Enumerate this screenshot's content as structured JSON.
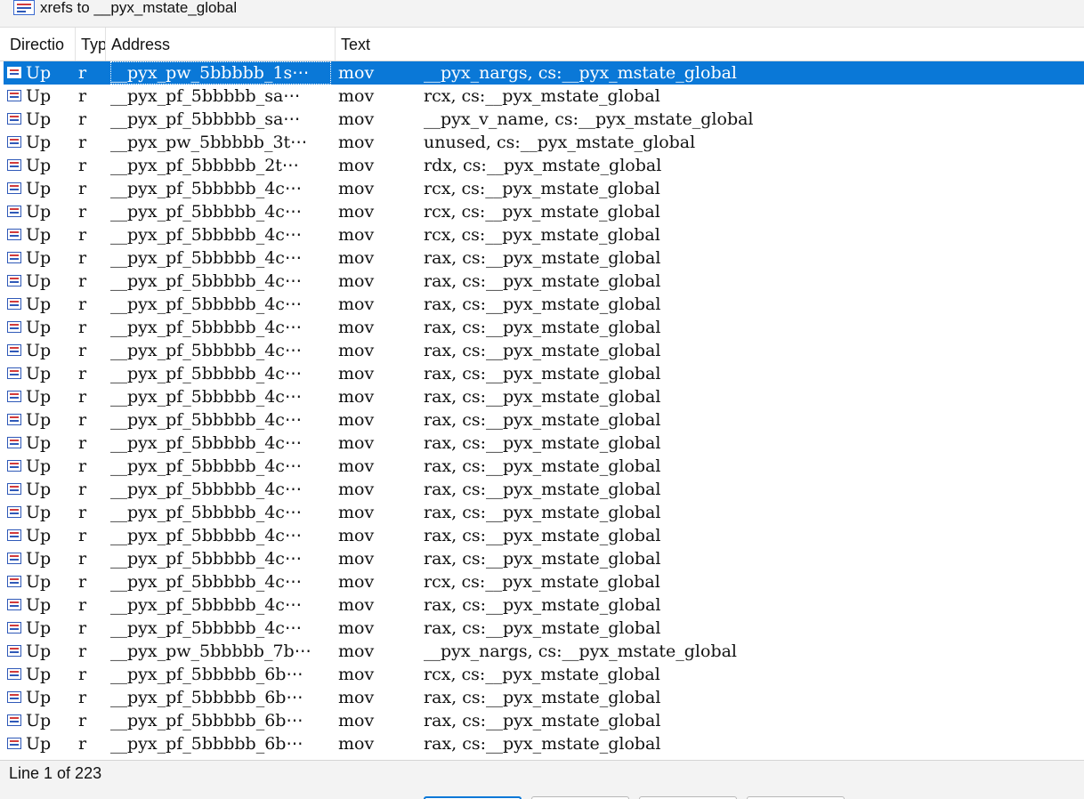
{
  "window": {
    "title": "xrefs to __pyx_mstate_global"
  },
  "columns": {
    "direction": "Directio",
    "type": "Typ",
    "address": "Address",
    "text": "Text"
  },
  "rows": [
    {
      "direction": "Up",
      "type": "r",
      "address": "__pyx_pw_5bbbbb_1s⋯",
      "op": "mov",
      "args": "__pyx_nargs, cs:__pyx_mstate_global",
      "selected": true
    },
    {
      "direction": "Up",
      "type": "r",
      "address": "__pyx_pf_5bbbbb_sa⋯",
      "op": "mov",
      "args": "rcx, cs:__pyx_mstate_global"
    },
    {
      "direction": "Up",
      "type": "r",
      "address": "__pyx_pf_5bbbbb_sa⋯",
      "op": "mov",
      "args": "__pyx_v_name, cs:__pyx_mstate_global"
    },
    {
      "direction": "Up",
      "type": "r",
      "address": "__pyx_pw_5bbbbb_3t⋯",
      "op": "mov",
      "args": "unused, cs:__pyx_mstate_global"
    },
    {
      "direction": "Up",
      "type": "r",
      "address": "__pyx_pf_5bbbbb_2t⋯",
      "op": "mov",
      "args": "rdx, cs:__pyx_mstate_global"
    },
    {
      "direction": "Up",
      "type": "r",
      "address": "__pyx_pf_5bbbbb_4c⋯",
      "op": "mov",
      "args": "rcx, cs:__pyx_mstate_global"
    },
    {
      "direction": "Up",
      "type": "r",
      "address": "__pyx_pf_5bbbbb_4c⋯",
      "op": "mov",
      "args": "rcx, cs:__pyx_mstate_global"
    },
    {
      "direction": "Up",
      "type": "r",
      "address": "__pyx_pf_5bbbbb_4c⋯",
      "op": "mov",
      "args": "rcx, cs:__pyx_mstate_global"
    },
    {
      "direction": "Up",
      "type": "r",
      "address": "__pyx_pf_5bbbbb_4c⋯",
      "op": "mov",
      "args": "rax, cs:__pyx_mstate_global"
    },
    {
      "direction": "Up",
      "type": "r",
      "address": "__pyx_pf_5bbbbb_4c⋯",
      "op": "mov",
      "args": "rax, cs:__pyx_mstate_global"
    },
    {
      "direction": "Up",
      "type": "r",
      "address": "__pyx_pf_5bbbbb_4c⋯",
      "op": "mov",
      "args": "rax, cs:__pyx_mstate_global"
    },
    {
      "direction": "Up",
      "type": "r",
      "address": "__pyx_pf_5bbbbb_4c⋯",
      "op": "mov",
      "args": "rax, cs:__pyx_mstate_global"
    },
    {
      "direction": "Up",
      "type": "r",
      "address": "__pyx_pf_5bbbbb_4c⋯",
      "op": "mov",
      "args": "rax, cs:__pyx_mstate_global"
    },
    {
      "direction": "Up",
      "type": "r",
      "address": "__pyx_pf_5bbbbb_4c⋯",
      "op": "mov",
      "args": "rax, cs:__pyx_mstate_global"
    },
    {
      "direction": "Up",
      "type": "r",
      "address": "__pyx_pf_5bbbbb_4c⋯",
      "op": "mov",
      "args": "rax, cs:__pyx_mstate_global"
    },
    {
      "direction": "Up",
      "type": "r",
      "address": "__pyx_pf_5bbbbb_4c⋯",
      "op": "mov",
      "args": "rax, cs:__pyx_mstate_global"
    },
    {
      "direction": "Up",
      "type": "r",
      "address": "__pyx_pf_5bbbbb_4c⋯",
      "op": "mov",
      "args": "rax, cs:__pyx_mstate_global"
    },
    {
      "direction": "Up",
      "type": "r",
      "address": "__pyx_pf_5bbbbb_4c⋯",
      "op": "mov",
      "args": "rax, cs:__pyx_mstate_global"
    },
    {
      "direction": "Up",
      "type": "r",
      "address": "__pyx_pf_5bbbbb_4c⋯",
      "op": "mov",
      "args": "rax, cs:__pyx_mstate_global"
    },
    {
      "direction": "Up",
      "type": "r",
      "address": "__pyx_pf_5bbbbb_4c⋯",
      "op": "mov",
      "args": "rax, cs:__pyx_mstate_global"
    },
    {
      "direction": "Up",
      "type": "r",
      "address": "__pyx_pf_5bbbbb_4c⋯",
      "op": "mov",
      "args": "rax, cs:__pyx_mstate_global"
    },
    {
      "direction": "Up",
      "type": "r",
      "address": "__pyx_pf_5bbbbb_4c⋯",
      "op": "mov",
      "args": "rax, cs:__pyx_mstate_global"
    },
    {
      "direction": "Up",
      "type": "r",
      "address": "__pyx_pf_5bbbbb_4c⋯",
      "op": "mov",
      "args": "rcx, cs:__pyx_mstate_global"
    },
    {
      "direction": "Up",
      "type": "r",
      "address": "__pyx_pf_5bbbbb_4c⋯",
      "op": "mov",
      "args": "rax, cs:__pyx_mstate_global"
    },
    {
      "direction": "Up",
      "type": "r",
      "address": "__pyx_pf_5bbbbb_4c⋯",
      "op": "mov",
      "args": "rax, cs:__pyx_mstate_global"
    },
    {
      "direction": "Up",
      "type": "r",
      "address": "__pyx_pw_5bbbbb_7b⋯",
      "op": "mov",
      "args": "__pyx_nargs, cs:__pyx_mstate_global"
    },
    {
      "direction": "Up",
      "type": "r",
      "address": "__pyx_pf_5bbbbb_6b⋯",
      "op": "mov",
      "args": "rcx, cs:__pyx_mstate_global"
    },
    {
      "direction": "Up",
      "type": "r",
      "address": "__pyx_pf_5bbbbb_6b⋯",
      "op": "mov",
      "args": "rax, cs:__pyx_mstate_global"
    },
    {
      "direction": "Up",
      "type": "r",
      "address": "__pyx_pf_5bbbbb_6b⋯",
      "op": "mov",
      "args": "rax, cs:__pyx_mstate_global"
    },
    {
      "direction": "Up",
      "type": "r",
      "address": "__pyx_pf_5bbbbb_6b⋯",
      "op": "mov",
      "args": "rax, cs:__pyx_mstate_global"
    }
  ],
  "status": {
    "line_info": "Line 1 of 223"
  },
  "icons": {
    "title_icon": "xref-list-icon",
    "row_icon": "xref-entry-icon"
  },
  "colors": {
    "selection": "#0a78d7",
    "title_bar": "#f3f3f3",
    "status_bar": "#f3f3f3"
  }
}
